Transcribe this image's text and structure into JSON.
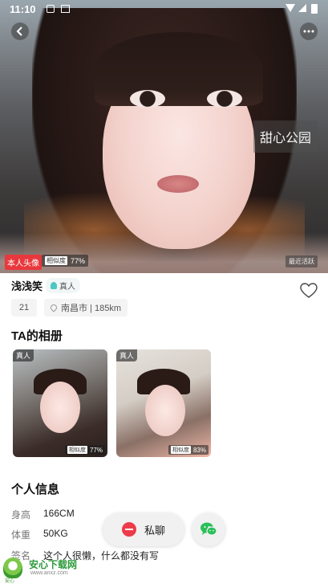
{
  "status_bar": {
    "time": "11:10"
  },
  "hero": {
    "watermark": "甜心公园",
    "self_badge": "本人头像",
    "similarity_tag": "相似度",
    "similarity_value": "77%",
    "active_badge": "最近活跃"
  },
  "profile": {
    "name": "浅浅笑",
    "verified_label": "真人",
    "age": "21",
    "location": "南昌市 | 185km"
  },
  "album": {
    "title": "TA的相册",
    "photos": [
      {
        "badge": "真人",
        "similarity_tag": "相似度",
        "similarity_value": "77%"
      },
      {
        "badge": "真人",
        "similarity_tag": "相似度",
        "similarity_value": "83%"
      }
    ]
  },
  "personal_info": {
    "title": "个人信息",
    "rows": [
      {
        "label": "身高",
        "value": "166CM"
      },
      {
        "label": "体重",
        "value": "50KG"
      },
      {
        "label": "签名",
        "value": "这个人很懒，什么都没有写"
      }
    ]
  },
  "actions": {
    "chat_label": "私聊"
  },
  "footer": {
    "brand": "安心下载网",
    "url": "www.anxz.com",
    "shield_text": "安心"
  },
  "colors": {
    "accent_red": "#e8383d",
    "verified_teal": "#4dc7c2",
    "wechat_green": "#2bbf5a"
  }
}
